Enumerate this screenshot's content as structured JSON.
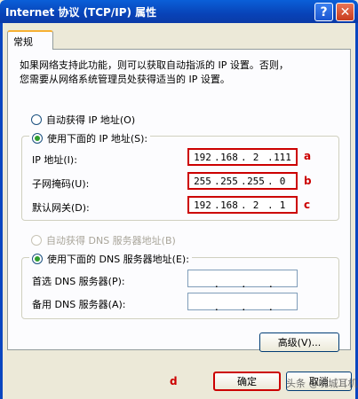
{
  "window": {
    "title": "Internet 协议 (TCP/IP) 属性"
  },
  "titlebar": {
    "help_glyph": "?",
    "close_glyph": "✕"
  },
  "tab": {
    "label": "常规"
  },
  "description": {
    "line1": "如果网络支持此功能，则可以获取自动指派的 IP 设置。否则，",
    "line2": "您需要从网络系统管理员处获得适当的 IP 设置。"
  },
  "ip_section": {
    "auto_label": "自动获得 IP 地址(O)",
    "manual_label": "使用下面的 IP 地址(S):",
    "selected": "manual",
    "ip_address": {
      "label": "IP 地址(I):",
      "octets": [
        "192",
        "168",
        "2",
        "111"
      ],
      "marker": "a"
    },
    "subnet_mask": {
      "label": "子网掩码(U):",
      "octets": [
        "255",
        "255",
        "255",
        "0"
      ],
      "marker": "b"
    },
    "gateway": {
      "label": "默认网关(D):",
      "octets": [
        "192",
        "168",
        "2",
        "1"
      ],
      "marker": "c"
    }
  },
  "dns_section": {
    "auto_label": "自动获得 DNS 服务器地址(B)",
    "manual_label": "使用下面的 DNS 服务器地址(E):",
    "selected": "manual",
    "preferred": {
      "label": "首选 DNS 服务器(P):",
      "octets": [
        "",
        "",
        "",
        ""
      ]
    },
    "alternate": {
      "label": "备用 DNS 服务器(A):",
      "octets": [
        "",
        "",
        "",
        ""
      ]
    }
  },
  "buttons": {
    "advanced": "高级(V)...",
    "ok": "确定",
    "cancel": "取消",
    "ok_marker": "d"
  },
  "watermark": "头条 @晚城耳机",
  "colors": {
    "highlight": "#cc0000",
    "titlebar": "#0843b8",
    "window_bg": "#ece9d8"
  }
}
